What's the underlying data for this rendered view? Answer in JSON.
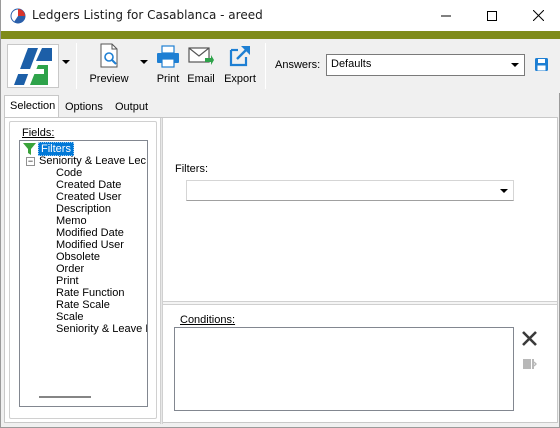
{
  "window": {
    "title": "Ledgers Listing for Casablanca - areed"
  },
  "toolbar": {
    "preview_label": "Preview",
    "print_label": "Print",
    "email_label": "Email",
    "export_label": "Export",
    "answers_label": "Answers:",
    "answers_value": "Defaults"
  },
  "tabs": [
    {
      "label": "Selection",
      "active": true
    },
    {
      "label": "Options",
      "active": false
    },
    {
      "label": "Output",
      "active": false
    }
  ],
  "fields": {
    "label": "Fields:",
    "root": "Filters",
    "group": "Seniority & Leave Lec",
    "items": [
      "Code",
      "Created Date",
      "Created User",
      "Description",
      "Memo",
      "Modified Date",
      "Modified User",
      "Obsolete",
      "Order",
      "Print",
      "Rate Function",
      "Rate Scale",
      "Scale",
      "Seniority & Leave I"
    ]
  },
  "filters": {
    "label": "Filters:",
    "value": ""
  },
  "conditions": {
    "label": "Conditions:"
  },
  "colors": {
    "accent_bar": "#7f8b1a",
    "selection": "#0078d7",
    "icon_blue": "#1e7fd3"
  }
}
